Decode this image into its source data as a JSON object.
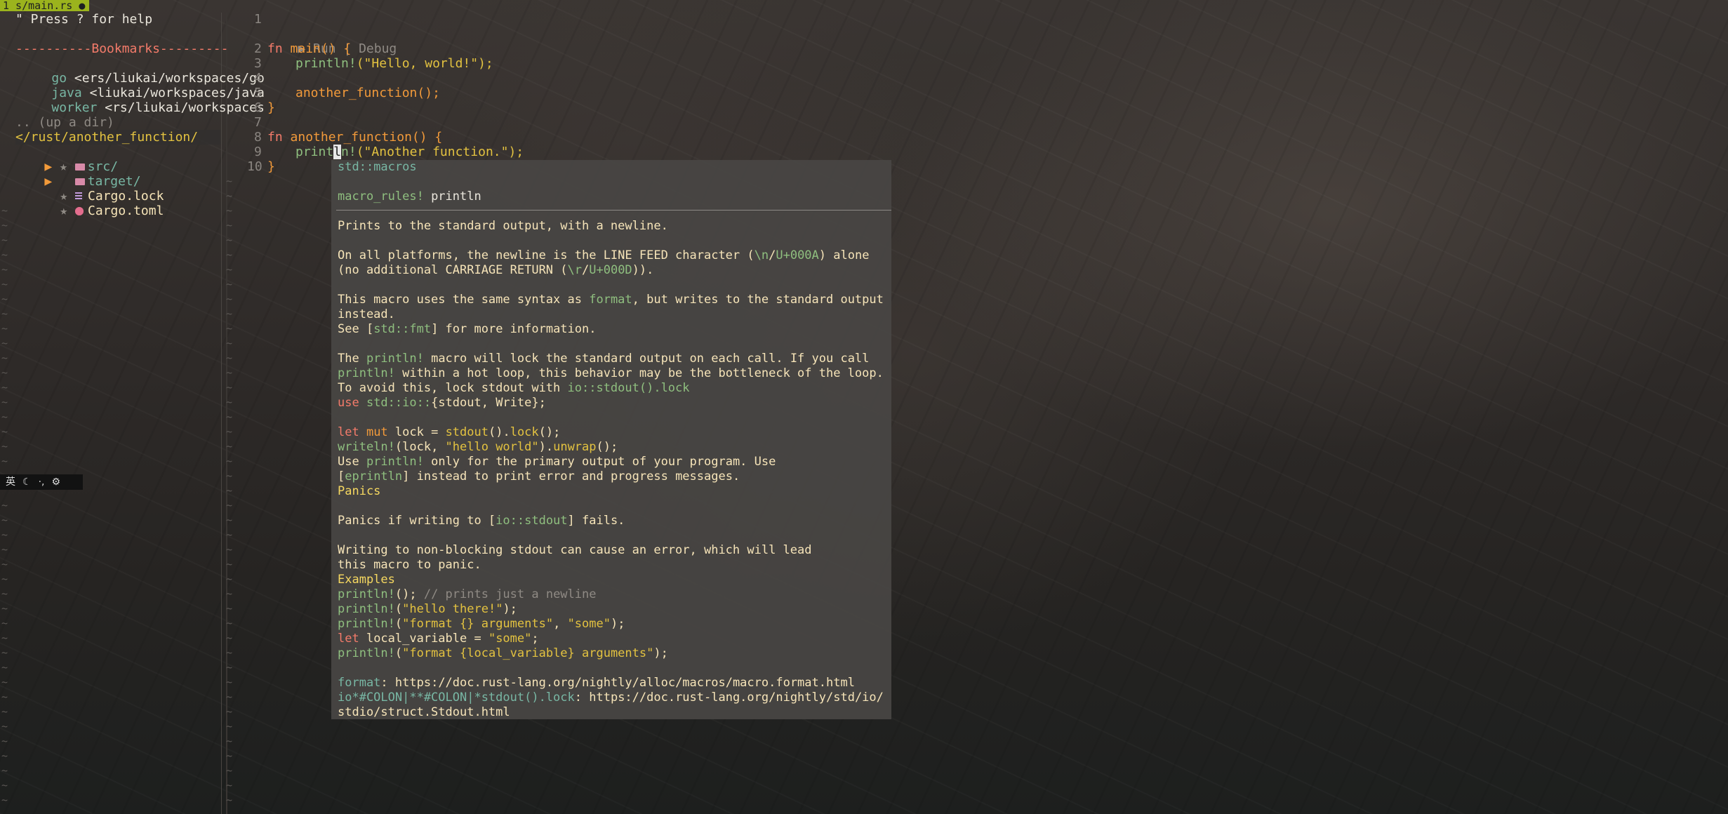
{
  "tab": {
    "label": "1 s/main.rs ●"
  },
  "sidebar": {
    "help": "\" Press ? for help",
    "bookmarks_header": "----------Bookmarks---------",
    "bookmarks": [
      {
        "name": "go",
        "path": "<ers/liukai/workspaces/go"
      },
      {
        "name": "java",
        "path": "<liukai/workspaces/java"
      },
      {
        "name": "worker",
        "path": "<rs/liukai/workspaces"
      }
    ],
    "up_dir": ".. (up a dir)",
    "cwd": "</rust/another_function/",
    "tree": [
      {
        "arrow": "▶",
        "mark": "★",
        "icon": "folder-icon",
        "name": "src/"
      },
      {
        "arrow": "▶",
        "mark": "",
        "icon": "folder-icon",
        "name": "target/"
      },
      {
        "arrow": "",
        "mark": "★",
        "icon": "lock-file-icon",
        "name": "Cargo.lock"
      },
      {
        "arrow": "",
        "mark": "★",
        "icon": "gear-icon",
        "name": "Cargo.toml"
      }
    ]
  },
  "widget": {
    "items": [
      "英",
      "☾",
      "·,",
      "⚙"
    ]
  },
  "editor": {
    "line_numbers": [
      "1",
      "2",
      "3",
      "4",
      "5",
      "6",
      "7",
      "8",
      "9",
      "10"
    ],
    "codelens": {
      "run": "▶ Run",
      "sep": " | ",
      "debug": "Debug"
    },
    "code": {
      "l2_fn": "fn ",
      "l2_name": "main",
      "l2_rest": "() {",
      "l3_macro": "println!",
      "l3_args": "(\"Hello, world!\");",
      "l5_call": "another_function",
      "l5_rest": "();",
      "l6": "}",
      "l8_fn": "fn ",
      "l8_name": "another_function",
      "l8_rest": "() {",
      "l9_pre": "print",
      "l9_cursor": "l",
      "l9_macro": "n!",
      "l9_args": "(\"Another function.\");",
      "l10": "}"
    }
  },
  "popup": {
    "path": "std::macros",
    "sig_kw": "macro_rules!",
    "sig_name": " println",
    "p1": "Prints to the standard output, with a newline.",
    "p2a": "On all platforms, the newline is the LINE FEED character (",
    "p2b": "\\n",
    "p2c": "/",
    "p2d": "U+000A",
    "p2e": ") alone",
    "p3a": "(no additional CARRIAGE RETURN (",
    "p3b": "\\r",
    "p3c": "/",
    "p3d": "U+000D",
    "p3e": ")).",
    "p4a": "This macro uses the same syntax as ",
    "p4b": "format",
    "p4c": ", but writes to the standard output",
    "p5": "instead.",
    "p6a": "See [",
    "p6b": "std::fmt",
    "p6c": "] for more information.",
    "p7a": "The ",
    "p7b": "println!",
    "p7c": " macro will lock the standard output on each call. If you call",
    "p8a": "println!",
    "p8b": " within a hot loop, this behavior may be the bottleneck of the loop.",
    "p9a": "To avoid this, lock stdout with ",
    "p9b": "io::stdout().lock",
    "p10a": "use ",
    "p10b": "std::io::",
    "p10c": "{stdout, Write};",
    "p11a": "let ",
    "p11b": "mut ",
    "p11c": "lock = ",
    "p11d": "stdout",
    "p11e": "().",
    "p11f": "lock",
    "p11g": "();",
    "p12a": "writeln!",
    "p12b": "(lock, ",
    "p12c": "\"hello world\"",
    "p12d": ").",
    "p12e": "unwrap",
    "p12f": "();",
    "p13a": "Use ",
    "p13b": "println!",
    "p13c": " only for the primary output of your program. Use",
    "p14a": "[",
    "p14b": "eprintln",
    "p14c": "] instead to print error and progress messages.",
    "p15": "Panics",
    "p16a": "Panics if writing to [",
    "p16b": "io::stdout",
    "p16c": "] fails.",
    "p17": "Writing to non-blocking stdout can cause an error, which will lead",
    "p18": "this macro to panic.",
    "p19": "Examples",
    "p20a": "println!",
    "p20b": "(); ",
    "p20c": "// prints just a newline",
    "p21a": "println!",
    "p21b": "(",
    "p21c": "\"hello there!\"",
    "p21d": ");",
    "p22a": "println!",
    "p22b": "(",
    "p22c": "\"format {} arguments\"",
    "p22d": ", ",
    "p22e": "\"some\"",
    "p22f": ");",
    "p23a": "let ",
    "p23b": "local_variable = ",
    "p23c": "\"some\"",
    "p23d": ";",
    "p24a": "println!",
    "p24b": "(",
    "p24c": "\"format {local_variable} arguments\"",
    "p24d": ");",
    "p25a": "format",
    "p25b": ": ",
    "p25c": "https://doc.rust-lang.org/nightly/alloc/macros/macro.format.html",
    "p26a": "io*#COLON|**#COLON|*stdout().lock",
    "p26b": ": ",
    "p26c": "https://doc.rust-lang.org/nightly/std/io/",
    "p27": "stdio/struct.Stdout.html"
  },
  "colors": {
    "tab_bg": "#9bb31d",
    "keyword": "#f47b6a",
    "function": "#f29a3a",
    "string": "#e3c240",
    "comment": "#8f8a84",
    "path": "#78b7a4"
  }
}
